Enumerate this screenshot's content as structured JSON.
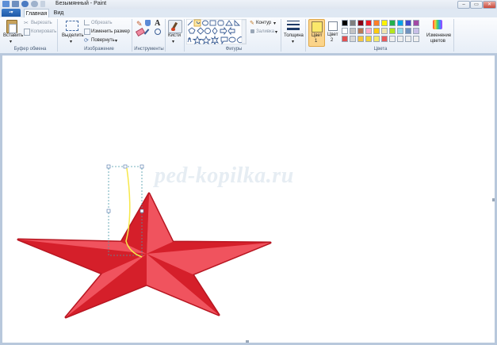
{
  "window": {
    "title": "Безымянный - Paint",
    "controls": {
      "minimize": "–",
      "maximize": "▭",
      "close": "✕"
    }
  },
  "tabs": {
    "file": "▪▾",
    "home": "Главная",
    "view": "Вид"
  },
  "clipboard": {
    "paste": "Вставить",
    "cut": "Вырезать",
    "copy": "Копировать",
    "group": "Буфер обмена"
  },
  "image": {
    "select": "Выделить",
    "crop": "Обрезать",
    "resize": "Изменить размер",
    "rotate": "Повернуть",
    "group": "Изображение"
  },
  "tools": {
    "group": "Инструменты",
    "text_tool": "A"
  },
  "brushes": {
    "label": "Кисти"
  },
  "shapes": {
    "outline": "Контур",
    "fill": "Заливка",
    "group": "Фигуры"
  },
  "size": {
    "label": "Толщина"
  },
  "colors": {
    "color1_line1": "Цвет",
    "color1_line2": "1",
    "color2_line1": "Цвет",
    "color2_line2": "2",
    "edit_line1": "Изменение",
    "edit_line2": "цветов",
    "group": "Цвета",
    "color1_value": "#fbe86a",
    "color2_value": "#ffffff",
    "palette_row1": [
      "#000000",
      "#7f7f7f",
      "#880015",
      "#ed1c24",
      "#ff7f27",
      "#fff200",
      "#22b14c",
      "#00a2e8",
      "#3f48cc",
      "#a349a4"
    ],
    "palette_row2": [
      "#ffffff",
      "#c3c3c3",
      "#b97a57",
      "#ffaec9",
      "#ffc90e",
      "#efe4b0",
      "#b5e61d",
      "#99d9ea",
      "#7092be",
      "#c8bfe7"
    ],
    "palette_row3": [
      "#e15050",
      "#d8d8d8",
      "#f5c542",
      "#f2d43c",
      "#f4e96b",
      "#e95a5a",
      "#eeeeee",
      "#eeeeee",
      "#eeeeee",
      "#eeeeee"
    ]
  },
  "canvas": {
    "watermark": "ped-kopilka.ru",
    "star_colors": {
      "light": "#f0535e",
      "dark": "#d51f2a",
      "outline": "#b81621"
    },
    "curve_color": "#f7e84a"
  }
}
